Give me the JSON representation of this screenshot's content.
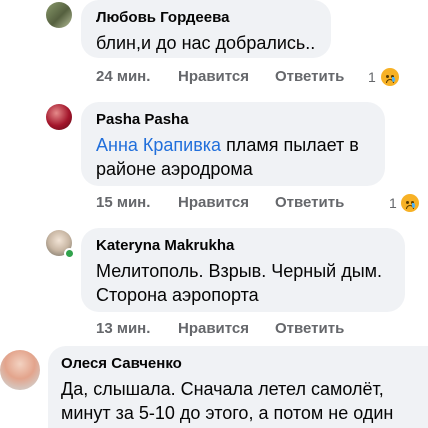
{
  "comments": [
    {
      "author": "Любовь Гордеева",
      "text": "блин,и до нас добрались..",
      "time": "24 мин.",
      "like_label": "Нравится",
      "reply_label": "Ответить",
      "reaction_count": "1",
      "reaction_icon": "sad-reaction-icon"
    },
    {
      "author": "Pasha Pasha",
      "mention": "Анна Крапивка",
      "text_line1": " пламя пылает в",
      "text_line2": "районе аэродрома",
      "time": "15 мин.",
      "like_label": "Нравится",
      "reply_label": "Ответить",
      "reaction_count": "1",
      "reaction_icon": "sad-reaction-icon"
    },
    {
      "author": "Kateryna Makrukha",
      "text_line1": "Мелитополь. Взрыв. Черный дым.",
      "text_line2": "Сторона аэропорта",
      "time": "13 мин.",
      "like_label": "Нравится",
      "reply_label": "Ответить",
      "online": true
    },
    {
      "author": "Олеся Савченко",
      "text_line1": "Да, слышала. Сначала летел самолёт,",
      "text_line2": "минут за 5-10 до этого, а потом не один"
    }
  ],
  "colors": {
    "bubble": "#f0f2f5",
    "mention": "#216fdb",
    "meta": "#65676b",
    "online": "#31a24c"
  }
}
